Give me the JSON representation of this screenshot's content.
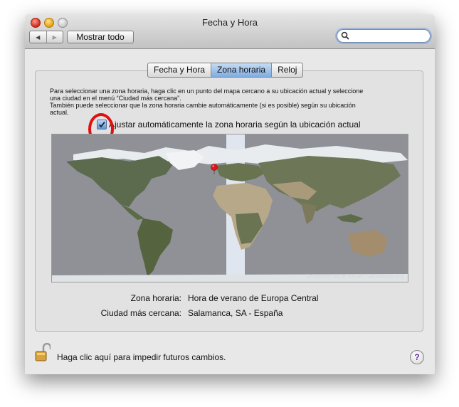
{
  "window": {
    "title": "Fecha y Hora"
  },
  "toolbar": {
    "show_all_label": "Mostrar todo",
    "back_glyph": "◀",
    "forward_glyph": "▶"
  },
  "search": {
    "value": "",
    "placeholder": ""
  },
  "tabs": [
    {
      "label": "Fecha y Hora",
      "selected": false
    },
    {
      "label": "Zona horaria",
      "selected": true
    },
    {
      "label": "Reloj",
      "selected": false
    }
  ],
  "timezone": {
    "instructions_1": "Para seleccionar una zona horaria, haga clic en un punto del mapa cercano a su ubicación actual y seleccione",
    "instructions_2": "una ciudad en el menú “Ciudad más cercana”.",
    "instructions_3": "También puede seleccionar que la zona horaria cambie automáticamente (si es posible) según su ubicación",
    "instructions_4": "actual.",
    "auto_checkbox_label": "Ajustar automáticamente la zona horaria según la ubicación actual",
    "auto_checked": true,
    "map_credit": "Imágenes de la NASA, Geonames.org",
    "zone_label": "Zona horaria:",
    "zone_value": "Hora de verano de Europa Central",
    "city_label": "Ciudad más cercana:",
    "city_value": "Salamanca, SA - España"
  },
  "footer": {
    "lock_text": "Haga clic aquí para impedir futuros cambios.",
    "help_label": "?"
  },
  "colors": {
    "highlight_band": "#dfe6ef",
    "pin": "#e01515",
    "annotation_circle": "#e01010",
    "selected_tab": "#7eacdf"
  }
}
